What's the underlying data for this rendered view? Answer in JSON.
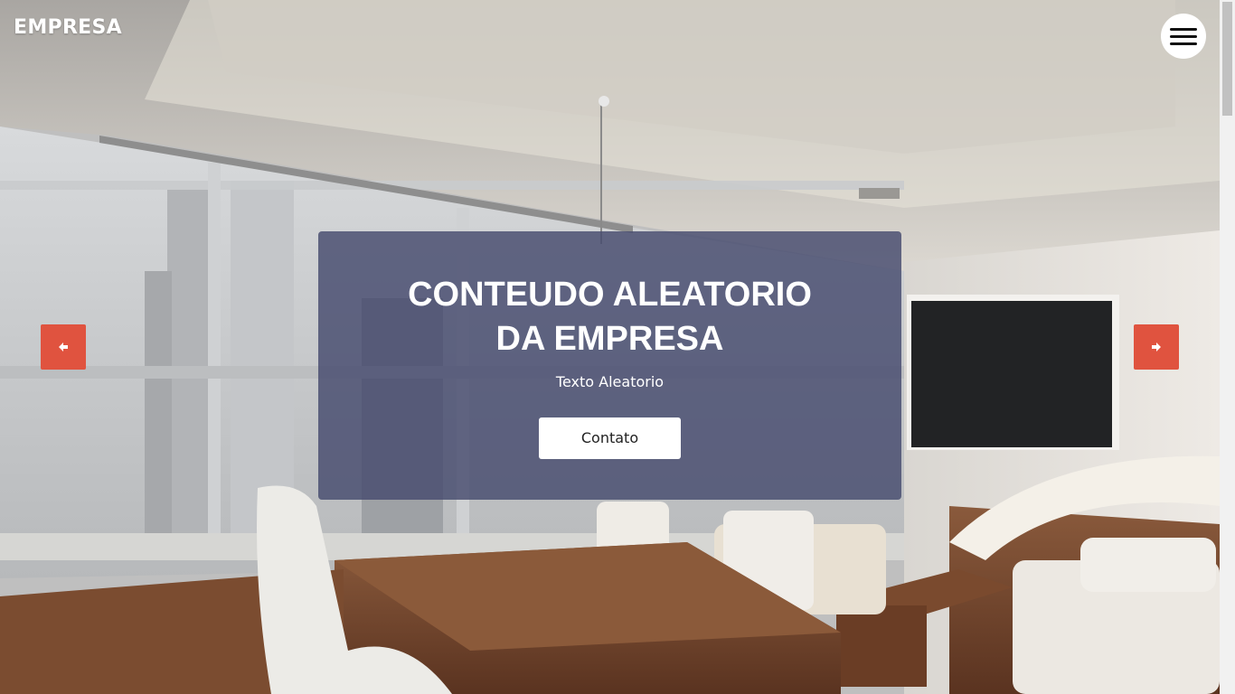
{
  "header": {
    "brand": "EMPRESA",
    "menu_icon": "hamburger-icon"
  },
  "hero": {
    "background_icon": "office-photo",
    "title_line1": "CONTEUDO ALEATORIO",
    "title_line2": "DA EMPRESA",
    "subtitle": "Texto Aleatorio",
    "cta_label": "Contato"
  },
  "carousel": {
    "prev_icon": "arrow-left-icon",
    "next_icon": "arrow-right-icon",
    "accent_color": "#e0533f"
  },
  "colors": {
    "panel_overlay": "#464a6e",
    "button_bg": "#ffffff"
  }
}
